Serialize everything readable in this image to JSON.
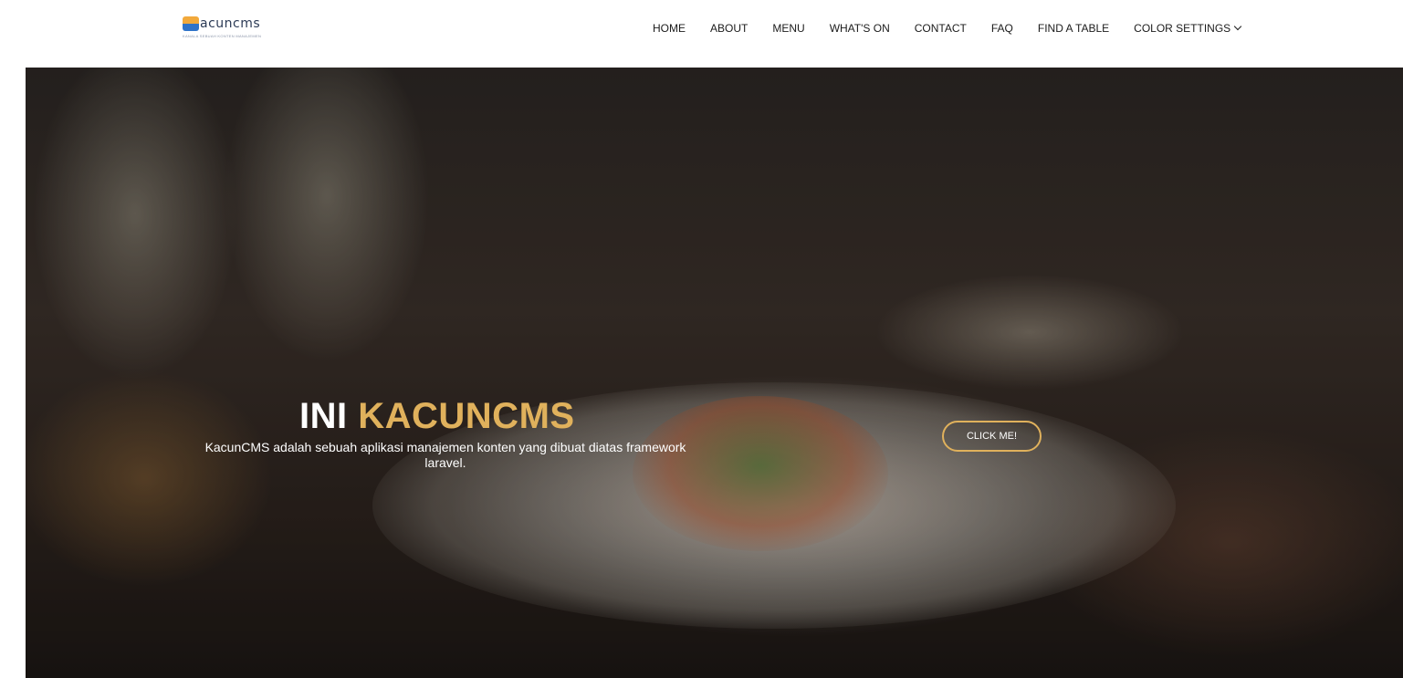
{
  "brand": {
    "name": "acuncms",
    "tagline": "KANALA SEBUAH KONTEN MANAJEMEN"
  },
  "nav": {
    "items": [
      {
        "label": "HOME"
      },
      {
        "label": "ABOUT"
      },
      {
        "label": "MENU"
      },
      {
        "label": "WHAT'S ON"
      },
      {
        "label": "CONTACT"
      },
      {
        "label": "FAQ"
      },
      {
        "label": "FIND A TABLE"
      },
      {
        "label": "COLOR SETTINGS"
      }
    ]
  },
  "hero": {
    "title_part1": "INI",
    "title_part2": "KACUNCMS",
    "subtitle": "KacunCMS adalah sebuah aplikasi manajemen konten yang dibuat diatas framework laravel.",
    "button_label": "CLICK ME!"
  },
  "colors": {
    "accent": "#e0b15c",
    "nav_text": "#1b1b1b",
    "logo_orange": "#f2a93b",
    "logo_blue": "#2f73c9"
  }
}
